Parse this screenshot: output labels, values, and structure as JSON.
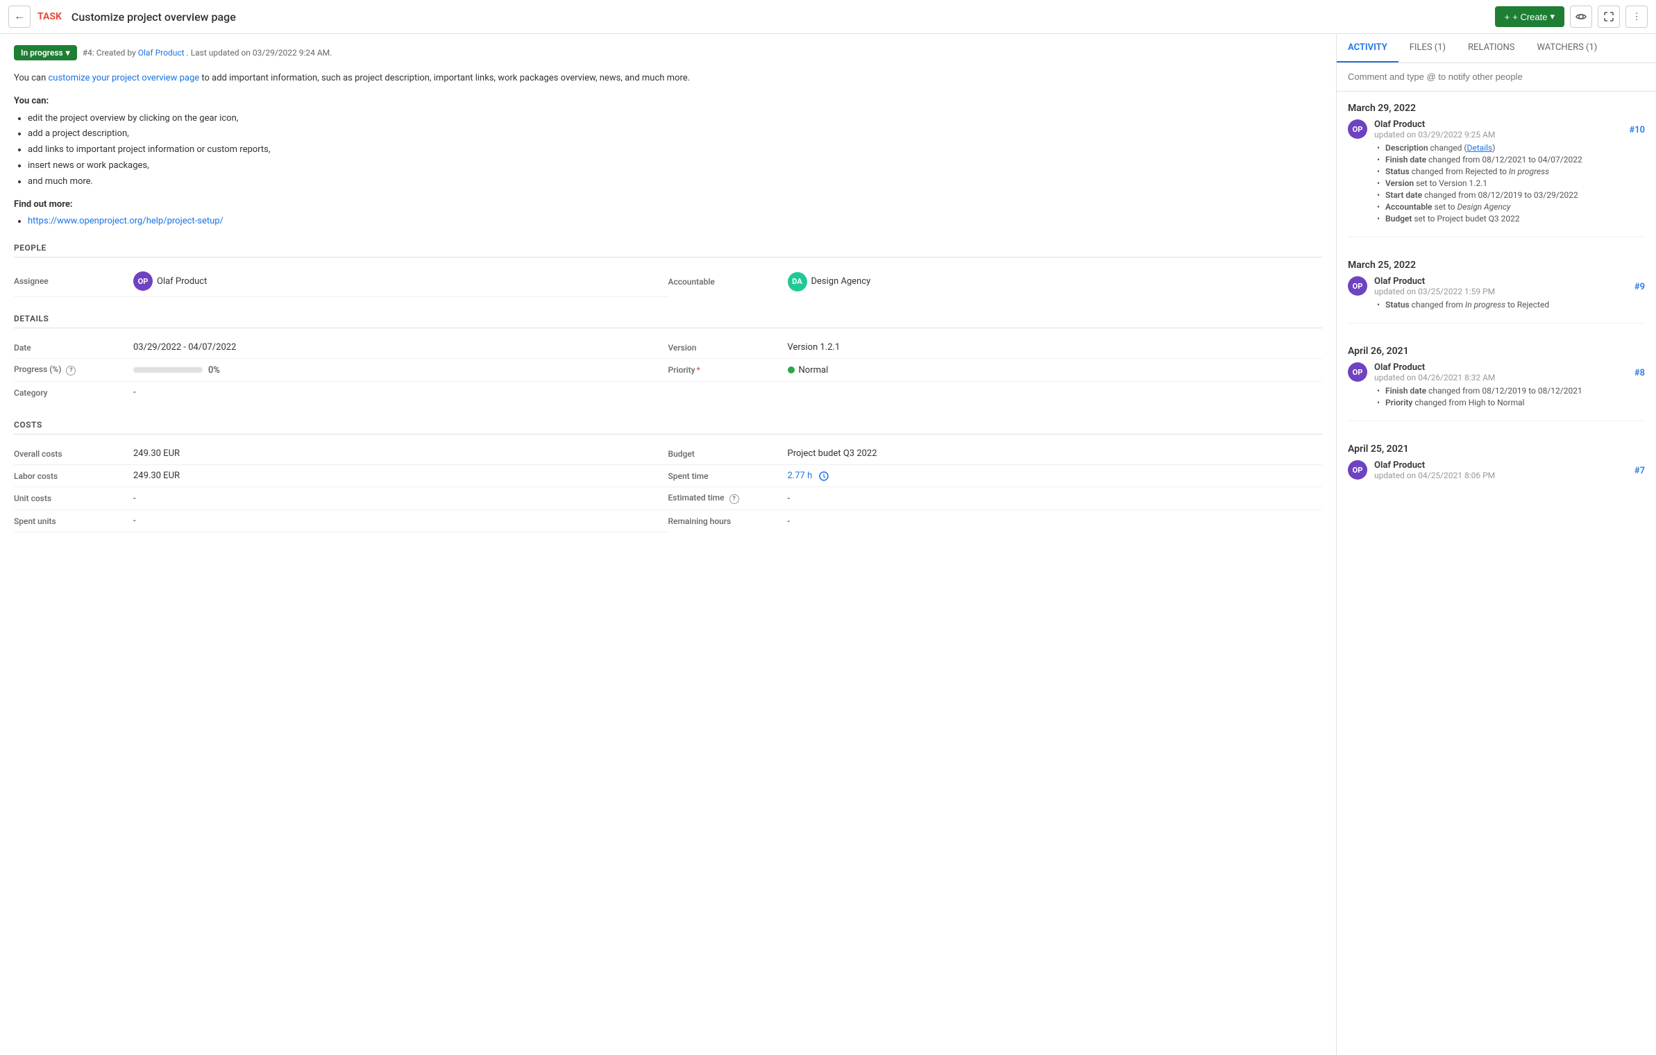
{
  "header": {
    "back_label": "←",
    "task_label": "TASK",
    "task_title": "Customize project overview page",
    "create_label": "+ Create",
    "create_arrow": "▾"
  },
  "status": {
    "badge": "In progress",
    "arrow": "▾",
    "meta": "#4: Created by",
    "creator": "Olaf Product",
    "meta_rest": ". Last updated on 03/29/2022 9:24 AM."
  },
  "description": {
    "intro_pre": "You can ",
    "intro_link": "customize your project overview page",
    "intro_post": " to add important information, such as project description, important links, work packages overview, news, and much more.",
    "you_can": "You can:",
    "bullets": [
      "edit the project overview by clicking on the gear icon,",
      "add a project description,",
      "add links to important project information or custom reports,",
      "insert news or work packages,",
      "and much more."
    ],
    "find_more": "Find out more:",
    "link": "https://www.openproject.org/help/project-setup/"
  },
  "people": {
    "section_title": "PEOPLE",
    "assignee_label": "Assignee",
    "assignee_value": "Olaf Product",
    "assignee_initials": "OP",
    "accountable_label": "Accountable",
    "accountable_value": "Design Agency",
    "accountable_initials": "DA"
  },
  "details": {
    "section_title": "DETAILS",
    "date_label": "Date",
    "date_value": "03/29/2022 - 04/07/2022",
    "version_label": "Version",
    "version_value": "Version 1.2.1",
    "progress_label": "Progress (%)",
    "progress_value": "0%",
    "progress_percent": 0,
    "priority_label": "Priority",
    "priority_required": "*",
    "priority_value": "Normal",
    "category_label": "Category",
    "category_value": "-"
  },
  "costs": {
    "section_title": "COSTS",
    "overall_label": "Overall costs",
    "overall_value": "249.30 EUR",
    "labor_label": "Labor costs",
    "labor_value": "249.30 EUR",
    "unit_label": "Unit costs",
    "unit_value": "-",
    "spent_units_label": "Spent units",
    "spent_units_value": "-",
    "budget_label": "Budget",
    "budget_value": "Project budet Q3 2022",
    "spent_time_label": "Spent time",
    "spent_time_value": "2.77 h",
    "estimated_label": "Estimated time",
    "estimated_value": "-",
    "remaining_label": "Remaining hours",
    "remaining_value": "-"
  },
  "right_panel": {
    "tabs": [
      {
        "label": "ACTIVITY",
        "active": true
      },
      {
        "label": "FILES (1)",
        "active": false
      },
      {
        "label": "RELATIONS",
        "active": false
      },
      {
        "label": "WATCHERS (1)",
        "active": false
      }
    ],
    "comment_placeholder": "Comment and type @ to notify other people",
    "dates": [
      {
        "label": "March 29, 2022",
        "items": [
          {
            "user": "Olaf Product",
            "initials": "OP",
            "time": "updated on 03/29/2022 9:25 AM",
            "num": "#10",
            "changes": [
              {
                "field": "Description",
                "text": " changed (",
                "link": "Details",
                "after": ")"
              },
              {
                "field": "Finish date",
                "text": " changed from 08/12/2021 to 04/07/2022"
              },
              {
                "field": "Status",
                "text": " changed from Rejected to ",
                "italic": "In progress"
              },
              {
                "field": "Version",
                "text": " set to Version 1.2.1"
              },
              {
                "field": "Start date",
                "text": " changed from 08/12/2019 to 03/29/2022"
              },
              {
                "field": "Accountable",
                "text": " set to ",
                "italic2": "Design Agency"
              },
              {
                "field": "Budget",
                "text": " set to Project budet Q3 2022"
              }
            ]
          }
        ]
      },
      {
        "label": "March 25, 2022",
        "items": [
          {
            "user": "Olaf Product",
            "initials": "OP",
            "time": "updated on 03/25/2022 1:59 PM",
            "num": "#9",
            "changes": [
              {
                "field": "Status",
                "text": " changed from ",
                "italic": "In progress",
                "text2": " to Rejected"
              }
            ]
          }
        ]
      },
      {
        "label": "April 26, 2021",
        "items": [
          {
            "user": "Olaf Product",
            "initials": "OP",
            "time": "updated on 04/26/2021 8:32 AM",
            "num": "#8",
            "changes": [
              {
                "field": "Finish date",
                "text": " changed from 08/12/2019 to 08/12/2021"
              },
              {
                "field": "Priority",
                "text": " changed from High to Normal"
              }
            ]
          }
        ]
      },
      {
        "label": "April 25, 2021",
        "items": [
          {
            "user": "Olaf Product",
            "initials": "OP",
            "time": "updated on 04/25/2021 8:06 PM",
            "num": "#7",
            "changes": []
          }
        ]
      }
    ]
  }
}
